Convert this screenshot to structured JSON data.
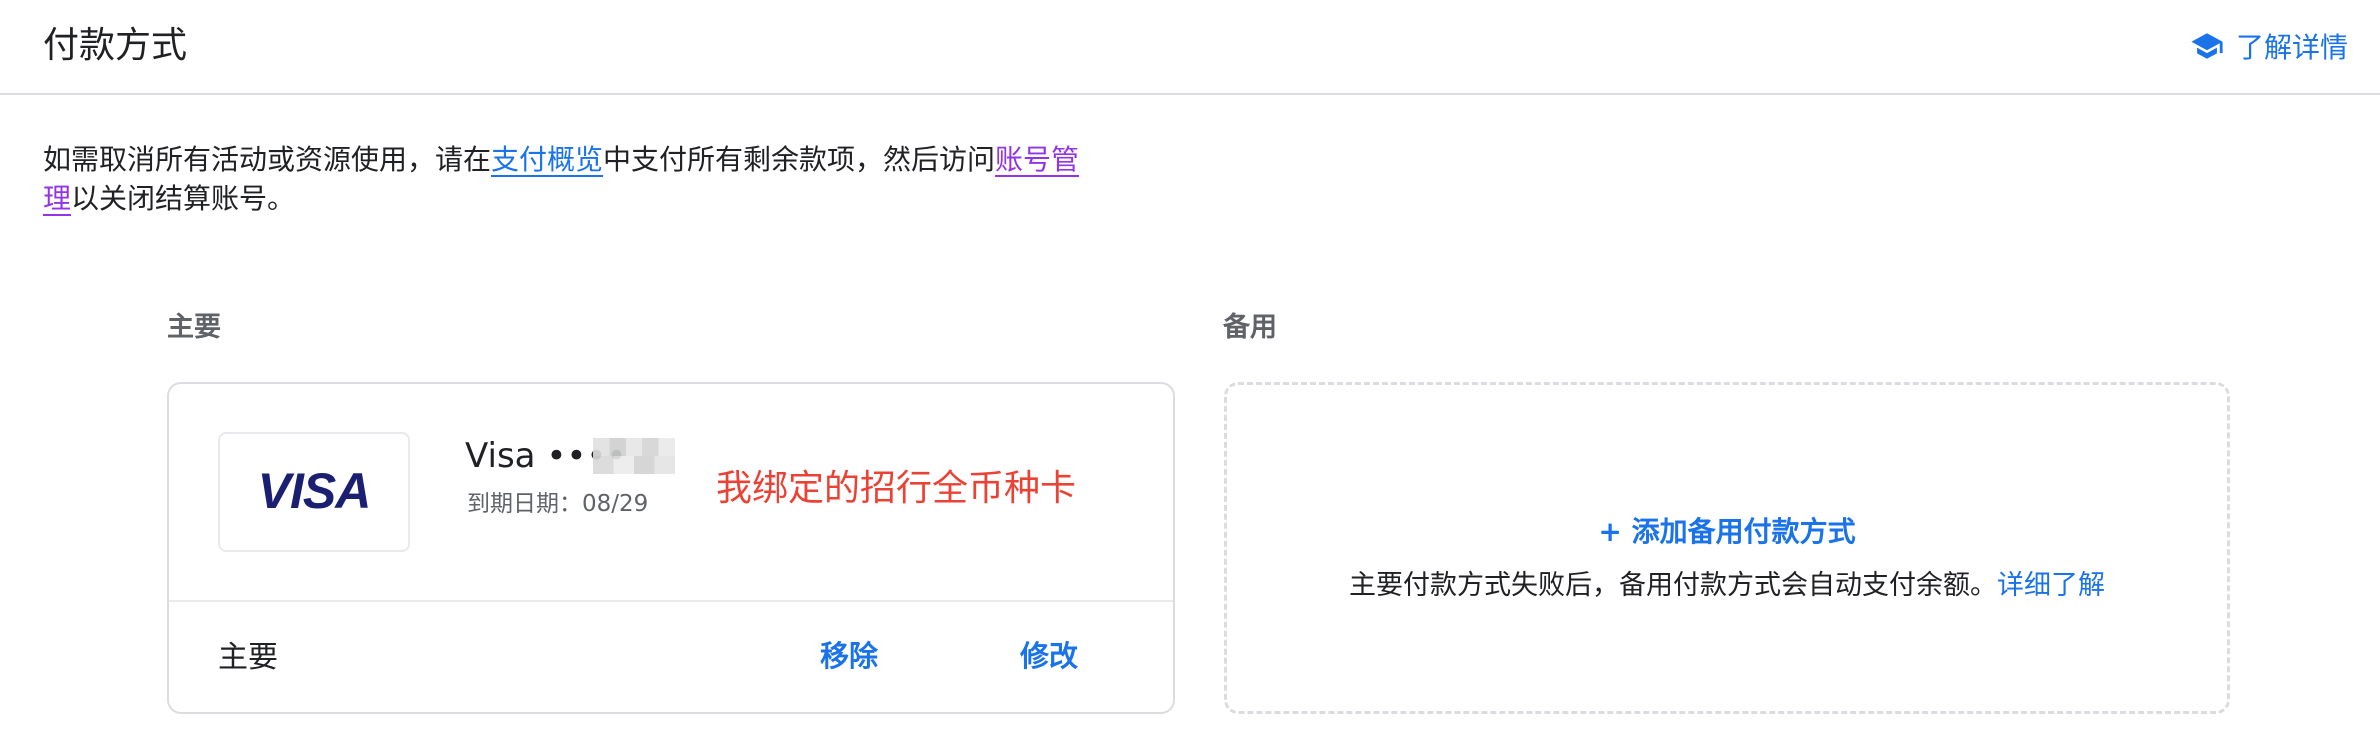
{
  "header": {
    "title": "付款方式",
    "learn_more_label": "了解详情",
    "learn_more_icon": "school-icon",
    "accent_color": "#1a73e8"
  },
  "intro": {
    "text_before": "如需取消所有活动或资源使用，请在",
    "billing_link": "支付概览",
    "text_middle": "中支付所有剩余款项，然后访问",
    "account_link": "账号管理",
    "text_after": "以关闭结算账号。"
  },
  "primary": {
    "section_label": "主要",
    "card": {
      "brand_icon": "visa-logo",
      "name": "Visa ••••",
      "expiry": "到期日期：08/29",
      "annotation": "我绑定的招行全币种卡",
      "annotation_color": "#ea4335"
    },
    "status_label": "主要",
    "remove_label": "移除",
    "edit_label": "修改"
  },
  "backup": {
    "section_label": "备用",
    "add_label": "+ 添加备用付款方式",
    "description": "主要付款方式失败后，备用付款方式会自动支付余额。",
    "details_link": "详细了解"
  }
}
